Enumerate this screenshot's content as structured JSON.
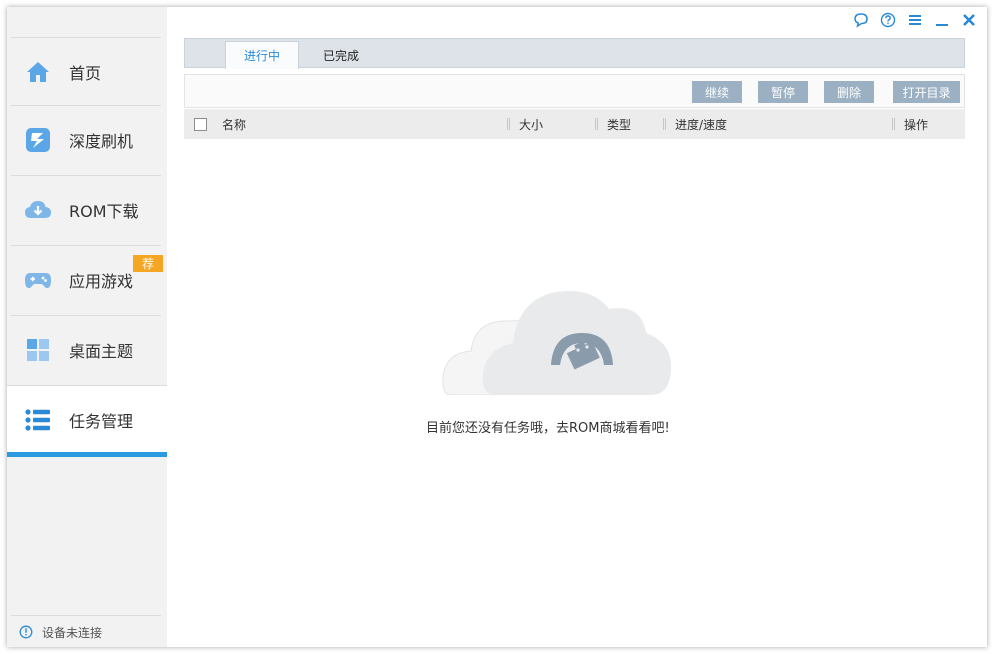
{
  "sidebar": {
    "items": [
      {
        "label": "首页",
        "icon": "home-icon"
      },
      {
        "label": "深度刷机",
        "icon": "flash-icon"
      },
      {
        "label": "ROM下载",
        "icon": "cloud-download-icon"
      },
      {
        "label": "应用游戏",
        "icon": "gamepad-icon",
        "badge": "荐"
      },
      {
        "label": "桌面主题",
        "icon": "grid-icon"
      },
      {
        "label": "任务管理",
        "icon": "list-icon",
        "active": true
      }
    ],
    "status": {
      "label": "设备未连接",
      "icon": "info-icon"
    }
  },
  "window_controls": [
    "feedback-icon",
    "help-icon",
    "menu-icon",
    "minimize-icon",
    "close-icon"
  ],
  "tabs": {
    "active": "进行中",
    "inactive": "已完成"
  },
  "toolbar": {
    "continue": "继续",
    "pause": "暂停",
    "delete": "删除",
    "open_dir": "打开目录"
  },
  "columns": {
    "name": "名称",
    "size": "大小",
    "type": "类型",
    "progress": "进度/速度",
    "action": "操作"
  },
  "empty": {
    "message": "目前您还没有任务哦，去ROM商城看看吧!"
  },
  "colors": {
    "accent": "#2a9be0",
    "badge": "#f5a623",
    "button": "#9bb0c3",
    "icon": "#5aa6e6"
  }
}
